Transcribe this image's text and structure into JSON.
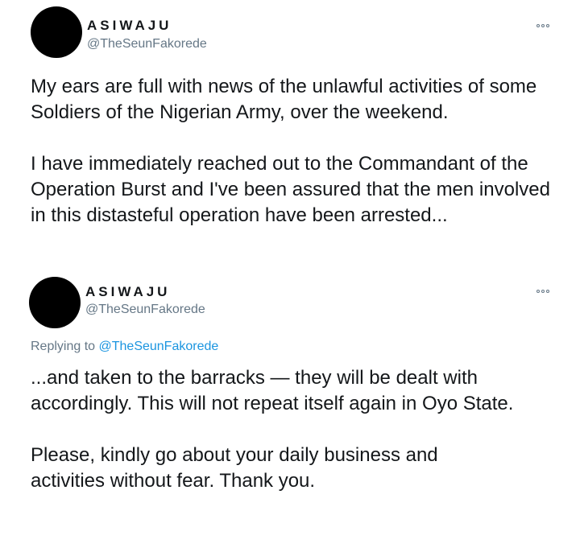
{
  "tweet1": {
    "display_name": "ASIWAJU",
    "handle": "@TheSeunFakorede",
    "more_icon": "more-horizontal-icon",
    "paragraphs": [
      "My ears are full with news of the unlawful activities of some Soldiers of the Nigerian Army, over the weekend.",
      "I have immediately reached out to the Commandant of the Operation Burst and I've been assured that the men involved in this distasteful operation have been arrested..."
    ]
  },
  "tweet2": {
    "display_name": "ASIWAJU",
    "handle": "@TheSeunFakorede",
    "more_icon": "more-horizontal-icon",
    "replying_prefix": "Replying to",
    "replying_handle": "@TheSeunFakorede",
    "paragraphs": [
      "...and taken to the barracks — they will be dealt with accordingly. This will not repeat itself again in Oyo State.",
      "Please, kindly go about your daily business and activities without fear. Thank you."
    ]
  },
  "colors": {
    "text": "#14171a",
    "secondary": "#657786",
    "link": "#1b95e0"
  }
}
